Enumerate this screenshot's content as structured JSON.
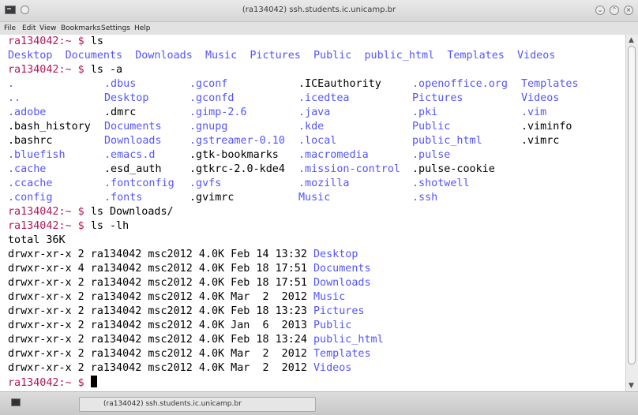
{
  "window": {
    "title": "(ra134042) ssh.students.ic.unicamp.br",
    "menu": [
      "File",
      "Edit",
      "View",
      "Bookmarks",
      "Settings",
      "Help"
    ]
  },
  "terminal": {
    "prompt": "ra134042:~ $",
    "cmd_ls": "ls",
    "ls_items": [
      "Desktop",
      "Documents",
      "Downloads",
      "Music",
      "Pictures",
      "Public",
      "public_html",
      "Templates",
      "Videos"
    ],
    "cmd_ls_a": "ls -a",
    "ls_a_rows": [
      [
        ".",
        ".dbus",
        ".gconf",
        ".ICEauthority",
        ".openoffice.org",
        "Templates"
      ],
      [
        "..",
        "Desktop",
        ".gconfd",
        ".icedtea",
        "Pictures",
        "Videos"
      ],
      [
        ".adobe",
        ".dmrc",
        ".gimp-2.6",
        ".java",
        ".pki",
        ".vim"
      ],
      [
        ".bash_history",
        "Documents",
        ".gnupg",
        ".kde",
        "Public",
        ".viminfo"
      ],
      [
        ".bashrc",
        "Downloads",
        ".gstreamer-0.10",
        ".local",
        "public_html",
        ".vimrc"
      ],
      [
        ".bluefish",
        ".emacs.d",
        ".gtk-bookmarks",
        ".macromedia",
        ".pulse",
        ""
      ],
      [
        ".cache",
        ".esd_auth",
        ".gtkrc-2.0-kde4",
        ".mission-control",
        ".pulse-cookie",
        ""
      ],
      [
        ".ccache",
        ".fontconfig",
        ".gvfs",
        ".mozilla",
        ".shotwell",
        ""
      ],
      [
        ".config",
        ".fonts",
        ".gvimrc",
        "Music",
        ".ssh",
        ""
      ]
    ],
    "cmd_ls_downloads": "ls Downloads/",
    "cmd_ls_lh": "ls -lh",
    "total": "total 36K",
    "lh_rows": [
      {
        "meta": "drwxr-xr-x 2 ra134042 msc2012 4.0K Feb 14 13:32",
        "name": "Desktop"
      },
      {
        "meta": "drwxr-xr-x 4 ra134042 msc2012 4.0K Feb 18 17:51",
        "name": "Documents"
      },
      {
        "meta": "drwxr-xr-x 2 ra134042 msc2012 4.0K Feb 18 17:51",
        "name": "Downloads"
      },
      {
        "meta": "drwxr-xr-x 2 ra134042 msc2012 4.0K Mar  2  2012",
        "name": "Music"
      },
      {
        "meta": "drwxr-xr-x 2 ra134042 msc2012 4.0K Feb 18 13:23",
        "name": "Pictures"
      },
      {
        "meta": "drwxr-xr-x 2 ra134042 msc2012 4.0K Jan  6  2013",
        "name": "Public"
      },
      {
        "meta": "drwxr-xr-x 2 ra134042 msc2012 4.0K Feb 18 13:24",
        "name": "public_html"
      },
      {
        "meta": "drwxr-xr-x 2 ra134042 msc2012 4.0K Mar  2  2012",
        "name": "Templates"
      },
      {
        "meta": "drwxr-xr-x 2 ra134042 msc2012 4.0K Mar  2  2012",
        "name": "Videos"
      }
    ]
  },
  "taskbar": {
    "task_label": "(ra134042) ssh.students.ic.unicamp.br"
  },
  "colors": {
    "prompt": "#b2185c",
    "directory": "#5454ff",
    "text": "#000000",
    "background": "#ffffff"
  },
  "icons": {
    "window": "terminal-icon",
    "minimize": "minimize-icon",
    "maximize": "maximize-icon",
    "close": "close-icon"
  }
}
